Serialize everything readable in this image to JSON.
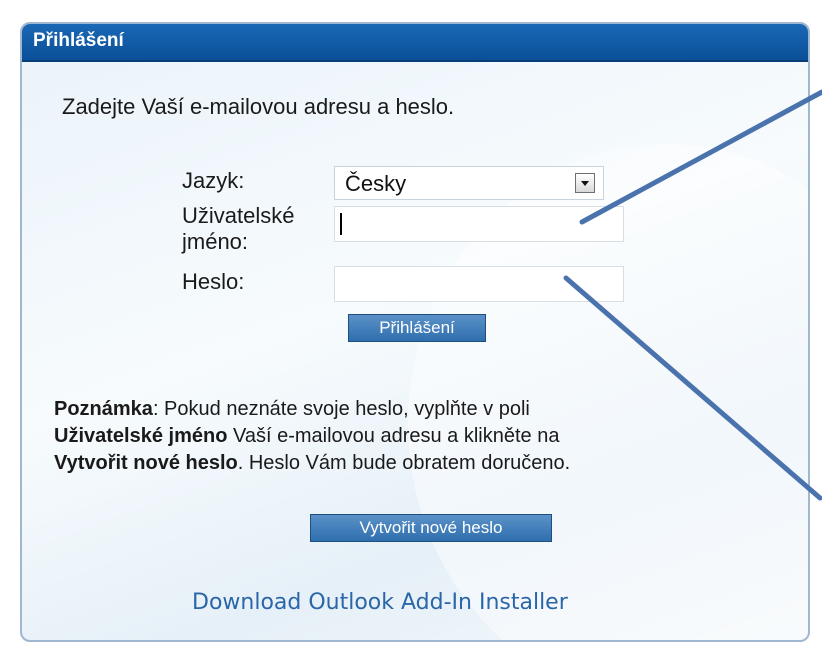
{
  "header": {
    "title": "Přihlášení"
  },
  "form": {
    "intro": "Zadejte Vaší e-mailovou adresu a heslo.",
    "language_label": "Jazyk:",
    "language_value": "Česky",
    "username_label_line1": "Uživatelské",
    "username_label_line2": "jméno:",
    "username_value": "",
    "password_label": "Heslo:",
    "password_value": "",
    "login_button": "Přihlášení"
  },
  "note": {
    "prefix_bold": "Poznámka",
    "text1": ": Pokud neznáte svoje heslo, vyplňte v poli",
    "field_bold": "Uživatelské jméno",
    "text2": " Vaší e-mailovou adresu a klikněte na",
    "action_bold": "Vytvořit nové heslo",
    "text3": ". Heslo Vám bude obratem doručeno."
  },
  "reset_button": "Vytvořit nové heslo",
  "addin_link": "Download Outlook Add-In Installer",
  "colors": {
    "header_blue": "#0b4f98",
    "button_blue": "#2f6fae",
    "link_blue": "#2a66a8",
    "annotation_arrow": "#4a73ad"
  }
}
